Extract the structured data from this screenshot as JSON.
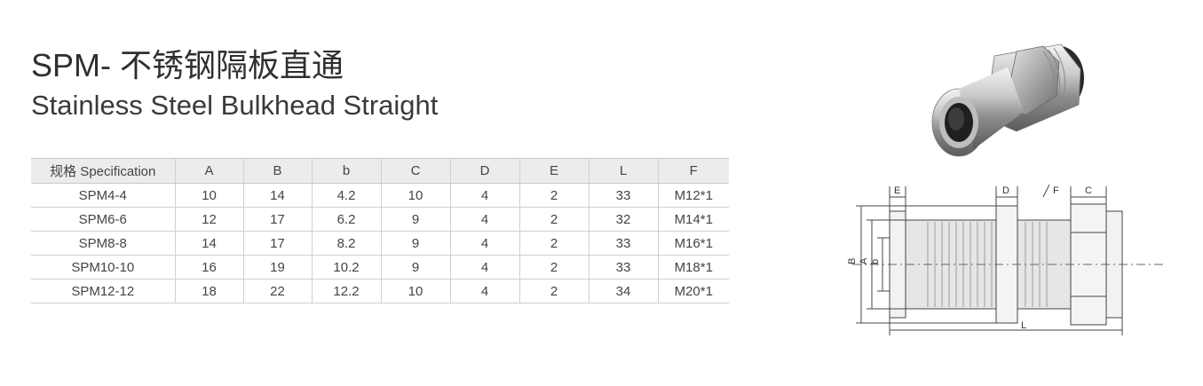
{
  "title_cn": "SPM- 不锈钢隔板直通",
  "title_en": "Stainless Steel Bulkhead Straight",
  "table": {
    "headers": [
      "规格 Specification",
      "A",
      "B",
      "b",
      "C",
      "D",
      "E",
      "L",
      "F"
    ],
    "rows": [
      [
        "SPM4-4",
        "10",
        "14",
        "4.2",
        "10",
        "4",
        "2",
        "33",
        "M12*1"
      ],
      [
        "SPM6-6",
        "12",
        "17",
        "6.2",
        "9",
        "4",
        "2",
        "32",
        "M14*1"
      ],
      [
        "SPM8-8",
        "14",
        "17",
        "8.2",
        "9",
        "4",
        "2",
        "33",
        "M16*1"
      ],
      [
        "SPM10-10",
        "16",
        "19",
        "10.2",
        "9",
        "4",
        "2",
        "33",
        "M18*1"
      ],
      [
        "SPM12-12",
        "18",
        "22",
        "12.2",
        "10",
        "4",
        "2",
        "34",
        "M20*1"
      ]
    ]
  },
  "drawing": {
    "labels": {
      "E": "E",
      "D": "D",
      "F": "F",
      "C": "C",
      "B": "B",
      "A": "A",
      "b": "b",
      "L": "L"
    }
  }
}
